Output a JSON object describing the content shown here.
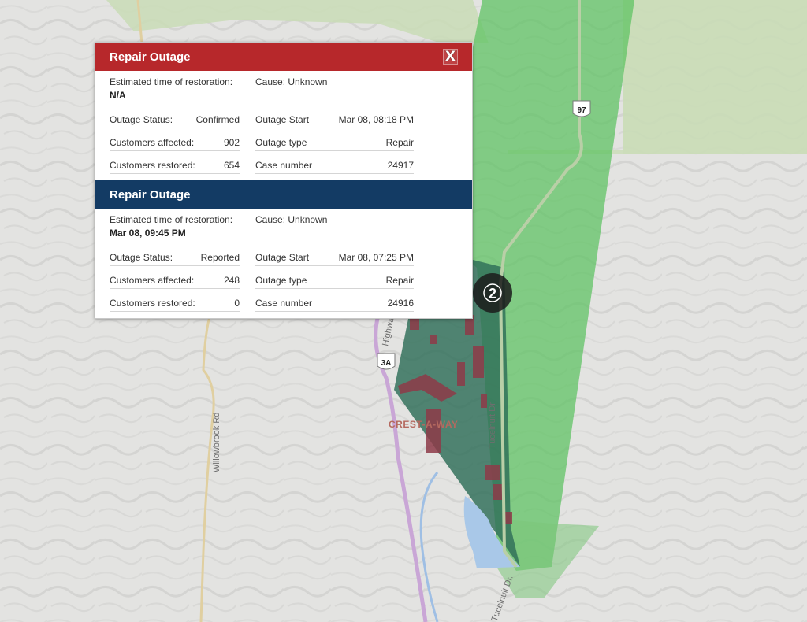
{
  "map": {
    "town_label": "CREST-A-WAY",
    "road_labels": [
      "Willowbrook Rd",
      "Highway",
      "Tucelnuit Dr",
      "Tucelnuit Dr."
    ],
    "highway_shields": [
      "97",
      "3A"
    ],
    "cluster_count": "2",
    "colors": {
      "land": "#e3e3e1",
      "park": "#c9dcb6",
      "outage_green": "#5cc25f",
      "outage_dark": "#2e6e58",
      "water": "#a9c8e8",
      "buildings": "#8e3b49",
      "highway": "#c9a6d6"
    }
  },
  "popup": {
    "close_label": "X",
    "outages": [
      {
        "title": "Repair Outage",
        "header_color": "#b7282b",
        "etr_label": "Estimated time of restoration:",
        "etr_value": "N/A",
        "cause": "Cause: Unknown",
        "status_label": "Outage Status:",
        "status_value": "Confirmed",
        "affected_label": "Customers affected:",
        "affected_value": "902",
        "restored_label": "Customers restored:",
        "restored_value": "654",
        "start_label": "Outage Start",
        "start_value": "Mar 08, 08:18 PM",
        "type_label": "Outage type",
        "type_value": "Repair",
        "case_label": "Case number",
        "case_value": "24917"
      },
      {
        "title": "Repair Outage",
        "header_color": "#133b64",
        "etr_label": "Estimated time of restoration:",
        "etr_value": "Mar 08, 09:45 PM",
        "cause": "Cause: Unknown",
        "status_label": "Outage Status:",
        "status_value": "Reported",
        "affected_label": "Customers affected:",
        "affected_value": "248",
        "restored_label": "Customers restored:",
        "restored_value": "0",
        "start_label": "Outage Start",
        "start_value": "Mar 08, 07:25 PM",
        "type_label": "Outage type",
        "type_value": "Repair",
        "case_label": "Case number",
        "case_value": "24916"
      }
    ]
  }
}
